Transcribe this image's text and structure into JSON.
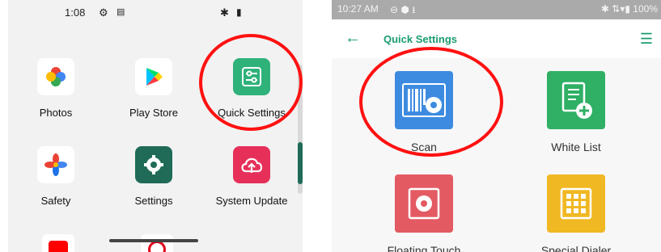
{
  "left_screen": {
    "status": {
      "time": "1:08",
      "gear_icon": "gear-icon",
      "sd_icon": "sdcard-icon",
      "bt_icon": "bluetooth-icon",
      "battery_icon": "battery-icon"
    },
    "apps": [
      {
        "label": "Photos"
      },
      {
        "label": "Play Store"
      },
      {
        "label": "Quick Settings"
      },
      {
        "label": "Safety"
      },
      {
        "label": "Settings"
      },
      {
        "label": "System Update"
      }
    ]
  },
  "right_screen": {
    "status": {
      "time": "10:27 AM",
      "battery_text": "100%"
    },
    "header": {
      "title": "Quick Settings"
    },
    "items": [
      {
        "label": "Scan"
      },
      {
        "label": "White List"
      },
      {
        "label": "Floating Touch"
      },
      {
        "label": "Special Dialer"
      }
    ]
  },
  "colors": {
    "accent_green": "#1a9c6f",
    "highlight_red": "#ff1111",
    "scan_blue": "#3d8be0",
    "whitelist_green": "#2fb065",
    "floating_red": "#e35a63",
    "dialer_yellow": "#f0b823"
  }
}
